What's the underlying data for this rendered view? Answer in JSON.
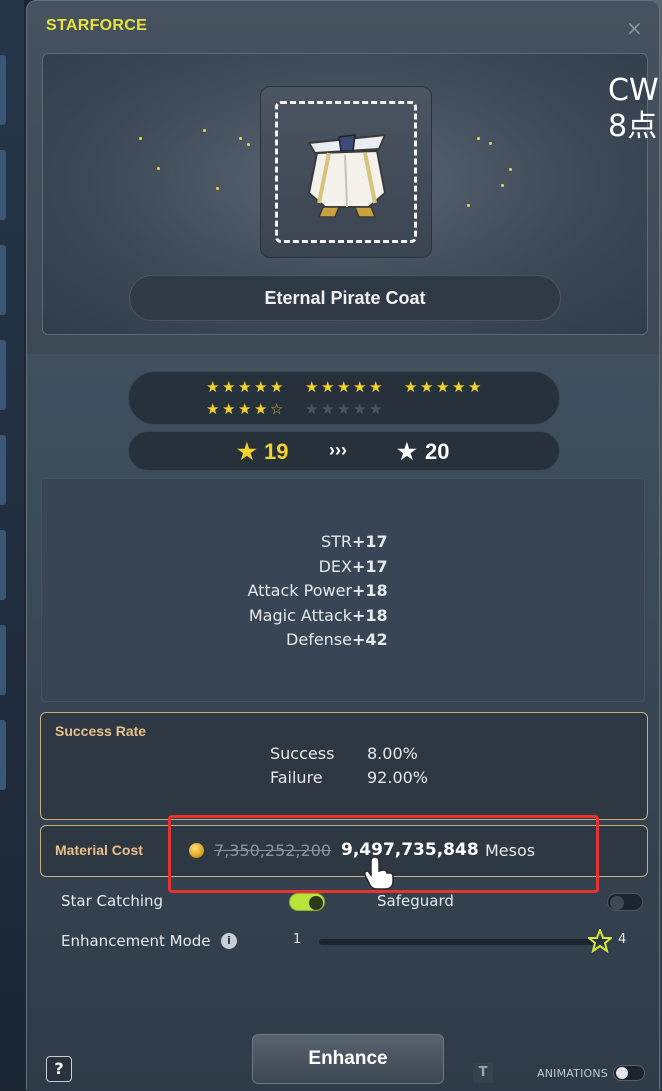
{
  "window": {
    "title": "STARFORCE",
    "close_icon": "×"
  },
  "background": {
    "text_line1": "CW",
    "text_line2": "8点"
  },
  "item": {
    "name": "Eternal Pirate Coat"
  },
  "stars": {
    "filled": 19,
    "total": 25,
    "current_level": "19",
    "arrow": "›››",
    "next_level": "20"
  },
  "stats": [
    {
      "name": "STR",
      "value": "+17"
    },
    {
      "name": "DEX",
      "value": "+17"
    },
    {
      "name": "Attack Power",
      "value": "+18"
    },
    {
      "name": "Magic Attack",
      "value": "+18"
    },
    {
      "name": "Defense",
      "value": "+42"
    }
  ],
  "success_rate": {
    "label": "Success Rate",
    "success_label": "Success",
    "success_value": "8.00%",
    "failure_label": "Failure",
    "failure_value": "92.00%"
  },
  "material_cost": {
    "label": "Material Cost",
    "old_cost": "7,350,252,200",
    "new_cost": "9,497,735,848",
    "unit": "Mesos"
  },
  "options": {
    "star_catching_label": "Star Catching",
    "star_catching_on": true,
    "safeguard_label": "Safeguard",
    "safeguard_on": false,
    "enhancement_mode_label": "Enhancement Mode",
    "info_icon": "i",
    "mode_min": "1",
    "mode_max": "4",
    "mode_value": 4
  },
  "buttons": {
    "enhance_label": "Enhance",
    "help_label": "?",
    "animations_label": "ANIMATIONS",
    "t_label": "T"
  },
  "colors": {
    "title": "#e7e23c",
    "star_on": "#f3d22a",
    "highlight": "#e53232",
    "toggle_on": "#b9e23a"
  }
}
